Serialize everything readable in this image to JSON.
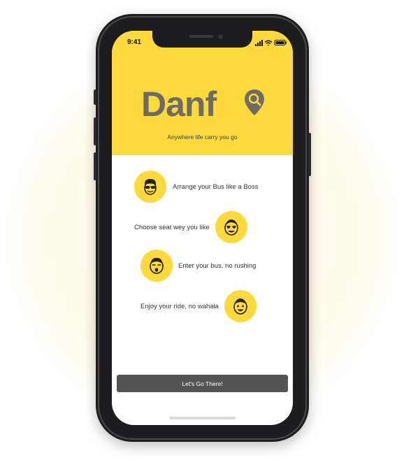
{
  "status_bar": {
    "time": "9:41"
  },
  "brand": {
    "name": "Danf",
    "tagline": "Anywhere life carry you go",
    "accent_color": "#fed93b",
    "logo_color": "#6d6b66"
  },
  "features": [
    {
      "text": "Arrange your Bus like a Boss",
      "icon": "sunglasses-face-icon"
    },
    {
      "text": "Choose seat wey you like",
      "icon": "heart-eyes-face-icon"
    },
    {
      "text": "Enter your bus, no rushing",
      "icon": "surprised-face-icon"
    },
    {
      "text": "Enjoy your ride, no wahala",
      "icon": "smiling-face-icon"
    }
  ],
  "cta": {
    "label": "Let's Go There!",
    "color": "#555555"
  }
}
